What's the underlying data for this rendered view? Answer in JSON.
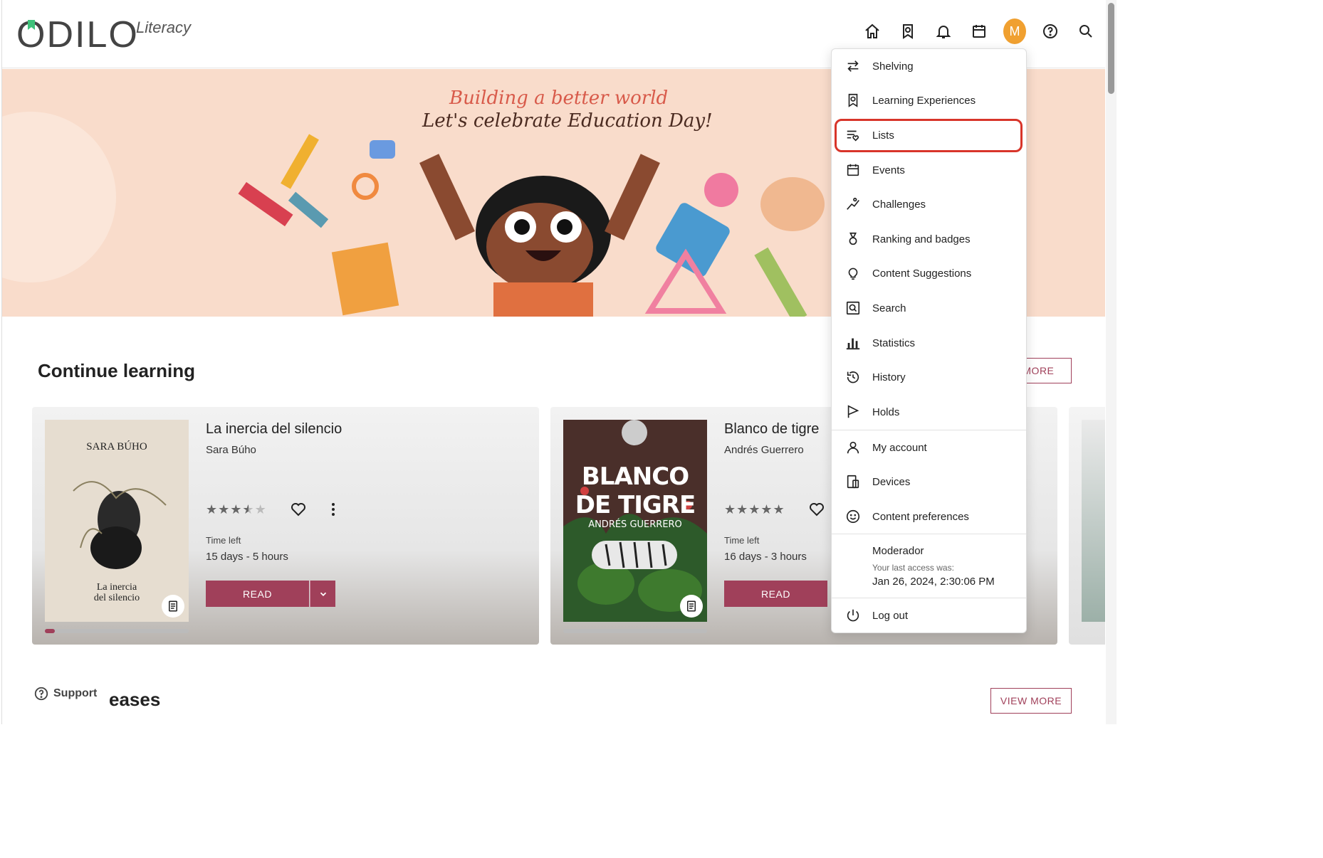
{
  "header": {
    "logo_text": "ODILO",
    "logo_sub": "Literacy",
    "avatar_letter": "M",
    "icons": [
      "home-icon",
      "bookmark-icon",
      "bell-icon",
      "calendar-icon",
      "avatar",
      "help-icon",
      "search-icon"
    ]
  },
  "banner": {
    "line1": "Building a better world",
    "line2": "Let's celebrate Education Day!"
  },
  "continue_learning": {
    "title": "Continue learning",
    "view_more": "VIEW MORE",
    "view_more_visible": "/ MORE",
    "cards": [
      {
        "title": "La inercia del silencio",
        "author": "Sara Búho",
        "cover_author": "SARA BÚHO",
        "cover_title_1": "La inercia",
        "cover_title_2": "del silencio",
        "stars": "★★★★★",
        "rating": 3.5,
        "time_label": "Time left",
        "time_value": "15 days - 5 hours",
        "read_label": "READ",
        "progress": 0.07
      },
      {
        "title": "Blanco de tigre",
        "author": "Andrés Guerrero",
        "cover_title_1": "BLANCO",
        "cover_title_2": "DE TIGRE",
        "cover_author": "ANDRÉS GUERRERO",
        "stars": "★★★★★",
        "rating": 5,
        "time_label": "Time left",
        "time_value": "16 days - 3 hours",
        "read_label": "READ",
        "progress": 0.0
      }
    ]
  },
  "new_releases": {
    "title_visible": "eases",
    "view_more": "VIEW MORE"
  },
  "support": {
    "label": "Support"
  },
  "menu": {
    "items": [
      {
        "label": "Shelving",
        "icon": "swap-icon"
      },
      {
        "label": "Learning Experiences",
        "icon": "bookmark-icon"
      },
      {
        "label": "Lists",
        "icon": "list-heart-icon"
      },
      {
        "label": "Events",
        "icon": "calendar-icon"
      },
      {
        "label": "Challenges",
        "icon": "challenge-icon"
      },
      {
        "label": "Ranking and badges",
        "icon": "medal-icon"
      },
      {
        "label": "Content Suggestions",
        "icon": "lightbulb-icon"
      },
      {
        "label": "Search",
        "icon": "search-box-icon"
      },
      {
        "label": "Statistics",
        "icon": "bar-chart-icon"
      },
      {
        "label": "History",
        "icon": "history-icon"
      },
      {
        "label": "Holds",
        "icon": "flag-icon"
      },
      {
        "label": "My account",
        "icon": "user-icon"
      },
      {
        "label": "Devices",
        "icon": "devices-icon"
      },
      {
        "label": "Content preferences",
        "icon": "smile-icon"
      }
    ],
    "user_name": "Moderador",
    "last_access_label": "Your last access was:",
    "last_access_date": "Jan 26, 2024, 2:30:06 PM",
    "logout": "Log out",
    "highlight_color": "#d8352a"
  },
  "colors": {
    "accent": "#a0405a",
    "avatar": "#f0a030",
    "banner_bg": "#f9dccb"
  }
}
